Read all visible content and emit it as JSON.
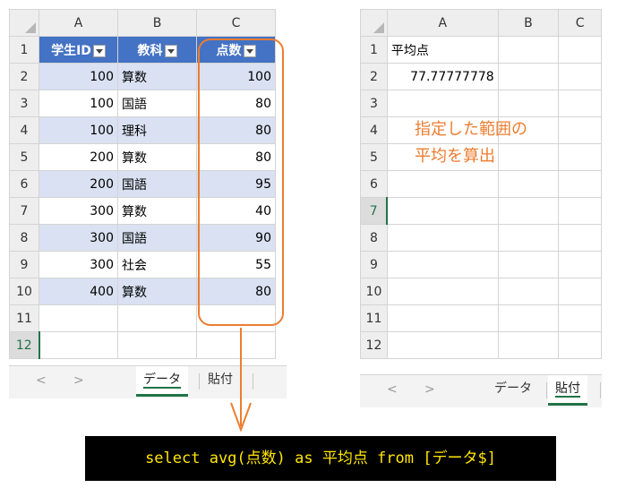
{
  "left_sheet": {
    "columns": [
      "A",
      "B",
      "C"
    ],
    "headers": [
      "学生ID",
      "教科",
      "点数"
    ],
    "rows": [
      {
        "row": "2",
        "id": "100",
        "subject": "算数",
        "score": "100"
      },
      {
        "row": "3",
        "id": "100",
        "subject": "国語",
        "score": "80"
      },
      {
        "row": "4",
        "id": "100",
        "subject": "理科",
        "score": "80"
      },
      {
        "row": "5",
        "id": "200",
        "subject": "算数",
        "score": "80"
      },
      {
        "row": "6",
        "id": "200",
        "subject": "国語",
        "score": "95"
      },
      {
        "row": "7",
        "id": "300",
        "subject": "算数",
        "score": "40"
      },
      {
        "row": "8",
        "id": "300",
        "subject": "国語",
        "score": "90"
      },
      {
        "row": "9",
        "id": "300",
        "subject": "社会",
        "score": "55"
      },
      {
        "row": "10",
        "id": "400",
        "subject": "算数",
        "score": "80"
      }
    ],
    "header_row": "1",
    "empty_rows": [
      "11",
      "12"
    ],
    "tabs": [
      "データ",
      "貼付"
    ],
    "nav_prev": "<",
    "nav_next": ">"
  },
  "right_sheet": {
    "columns": [
      "A",
      "B",
      "C"
    ],
    "rows": [
      "1",
      "2",
      "3",
      "4",
      "5",
      "6",
      "7",
      "8",
      "9",
      "10",
      "11",
      "12"
    ],
    "a1": "平均点",
    "a2": "77.77777778",
    "tabs": [
      "データ",
      "貼付"
    ],
    "nav_prev": "<",
    "nav_next": ">"
  },
  "annotation": {
    "line1": "指定した範囲の",
    "line2": "平均を算出"
  },
  "sql": "select avg(点数) as 平均点 from [データ$]",
  "colors": {
    "accent": "#ed7d31",
    "header": "#4472c4",
    "band": "#d9e1f2",
    "excel_green": "#217346",
    "sql_text": "#ffe600"
  }
}
